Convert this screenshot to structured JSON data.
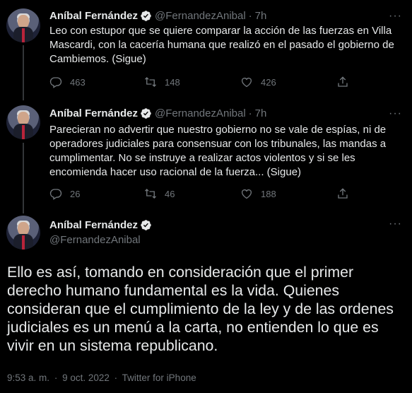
{
  "tweets": [
    {
      "name": "Aníbal Fernández",
      "handle": "@FernandezAnibal",
      "separator": "·",
      "time": "7h",
      "text": "Leo con estupor que se quiere comparar la acción de las fuerzas en Villa Mascardi, con la cacería humana que realizó en el pasado el gobierno de Cambiemos. (Sigue)",
      "replies": "463",
      "retweets": "148",
      "likes": "426"
    },
    {
      "name": "Aníbal Fernández",
      "handle": "@FernandezAnibal",
      "separator": "·",
      "time": "7h",
      "text": "Parecieran no advertir que nuestro gobierno no se vale de espías, ni de operadores judiciales para consensuar con los tribunales, las mandas a cumplimentar. No se instruye a realizar actos violentos y si se les encomienda hacer uso racional de la fuerza... (Sigue)",
      "replies": "26",
      "retweets": "46",
      "likes": "188"
    }
  ],
  "main_tweet": {
    "name": "Aníbal Fernández",
    "handle": "@FernandezAnibal",
    "text": "Ello es así, tomando en consideración que el primer derecho humano fundamental es la vida. Quienes consideran que el cumplimiento de la ley y de las ordenes judiciales es un menú a la carta, no entienden lo que es vivir en un sistema republicano.",
    "time": "9:53 a. m.",
    "date": "9 oct. 2022",
    "separator": "·",
    "source": "Twitter for iPhone"
  },
  "more_label": "···",
  "colors": {
    "background": "#000000",
    "text": "#e7e9ea",
    "muted": "#71767b",
    "verified": "#1d9bf0"
  },
  "icons": [
    "reply-icon",
    "retweet-icon",
    "like-icon",
    "share-icon",
    "verified-badge-icon",
    "more-icon"
  ]
}
